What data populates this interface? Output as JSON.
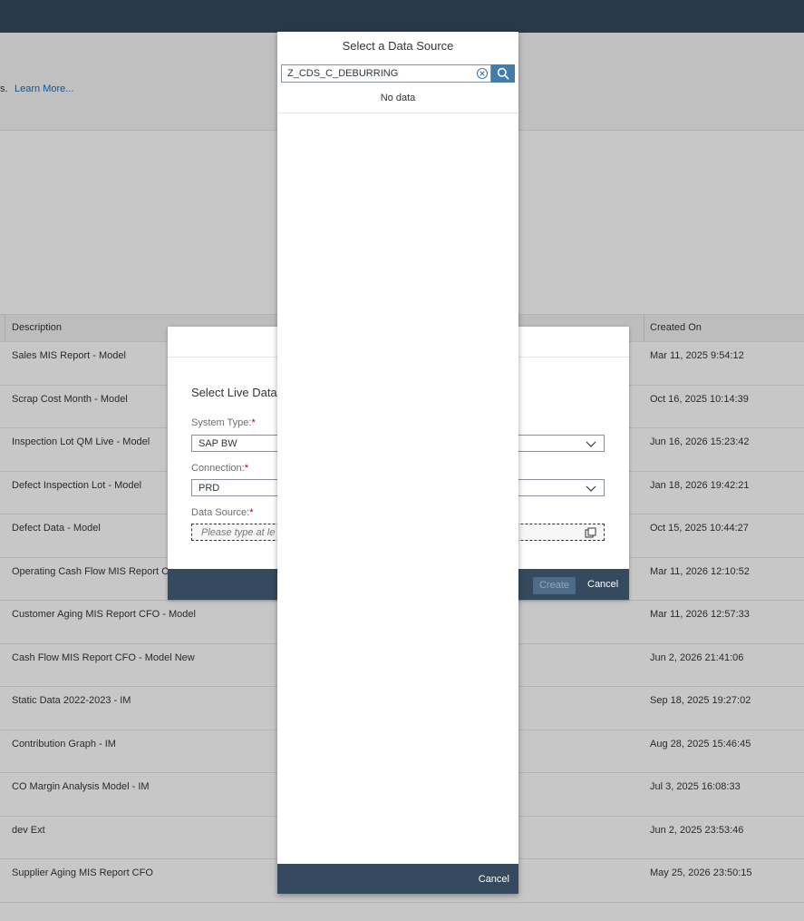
{
  "background": {
    "info_prefix": "s.",
    "learn_more": "Learn More...",
    "table": {
      "headers": {
        "description": "Description",
        "created_on": "Created On"
      },
      "rows": [
        {
          "description": "Sales MIS Report - Model",
          "created_on": "Mar 11, 2025 9:54:12"
        },
        {
          "description": "Scrap Cost Month - Model",
          "created_on": "Oct 16, 2025 10:14:39"
        },
        {
          "description": "Inspection Lot QM Live - Model",
          "created_on": "Jun 16, 2026 15:23:42"
        },
        {
          "description": "Defect Inspection Lot - Model",
          "created_on": "Jan 18, 2026 19:42:21"
        },
        {
          "description": "Defect Data - Model",
          "created_on": "Oct 15, 2025 10:44:27"
        },
        {
          "description": "Operating Cash Flow MIS Report C",
          "created_on": "Mar 11, 2026 12:10:52"
        },
        {
          "description": "Customer Aging MIS Report CFO - Model",
          "created_on": "Mar 11, 2026 12:57:33"
        },
        {
          "description": "Cash Flow MIS Report CFO - Model New",
          "created_on": "Jun 2, 2026 21:41:06"
        },
        {
          "description": "Static Data 2022-2023 - IM",
          "created_on": "Sep 18, 2025 19:27:02"
        },
        {
          "description": "Contribution Graph - IM",
          "created_on": "Aug 28, 2025 15:46:45"
        },
        {
          "description": "CO Margin Analysis Model - IM",
          "created_on": "Jul 3, 2025 16:08:33"
        },
        {
          "description": "dev Ext",
          "created_on": "Jun 2, 2025 23:53:46"
        },
        {
          "description": "Supplier Aging MIS Report CFO",
          "created_on": "May 25, 2026 23:50:15"
        }
      ]
    }
  },
  "live_dialog": {
    "title": "Select Live Data",
    "system_type_label": "System Type:",
    "system_type_value": "SAP BW",
    "connection_label": "Connection:",
    "connection_value": "PRD",
    "data_source_label": "Data Source:",
    "data_source_placeholder": "Please type at le",
    "required_mark": "*",
    "create_label": "Create",
    "cancel_label": "Cancel"
  },
  "source_dialog": {
    "title": "Select a Data Source",
    "search_value": "Z_CDS_C_DEBURRING",
    "no_data": "No data",
    "cancel_label": "Cancel"
  },
  "colors": {
    "shell": "#354a5f",
    "accent": "#427cac",
    "link": "#0a6ed1",
    "required": "#bb0000"
  },
  "icons": {
    "clear": "clear-circle-icon",
    "search": "search-icon",
    "dropdown": "chevron-down-icon",
    "value_help": "value-help-icon"
  }
}
